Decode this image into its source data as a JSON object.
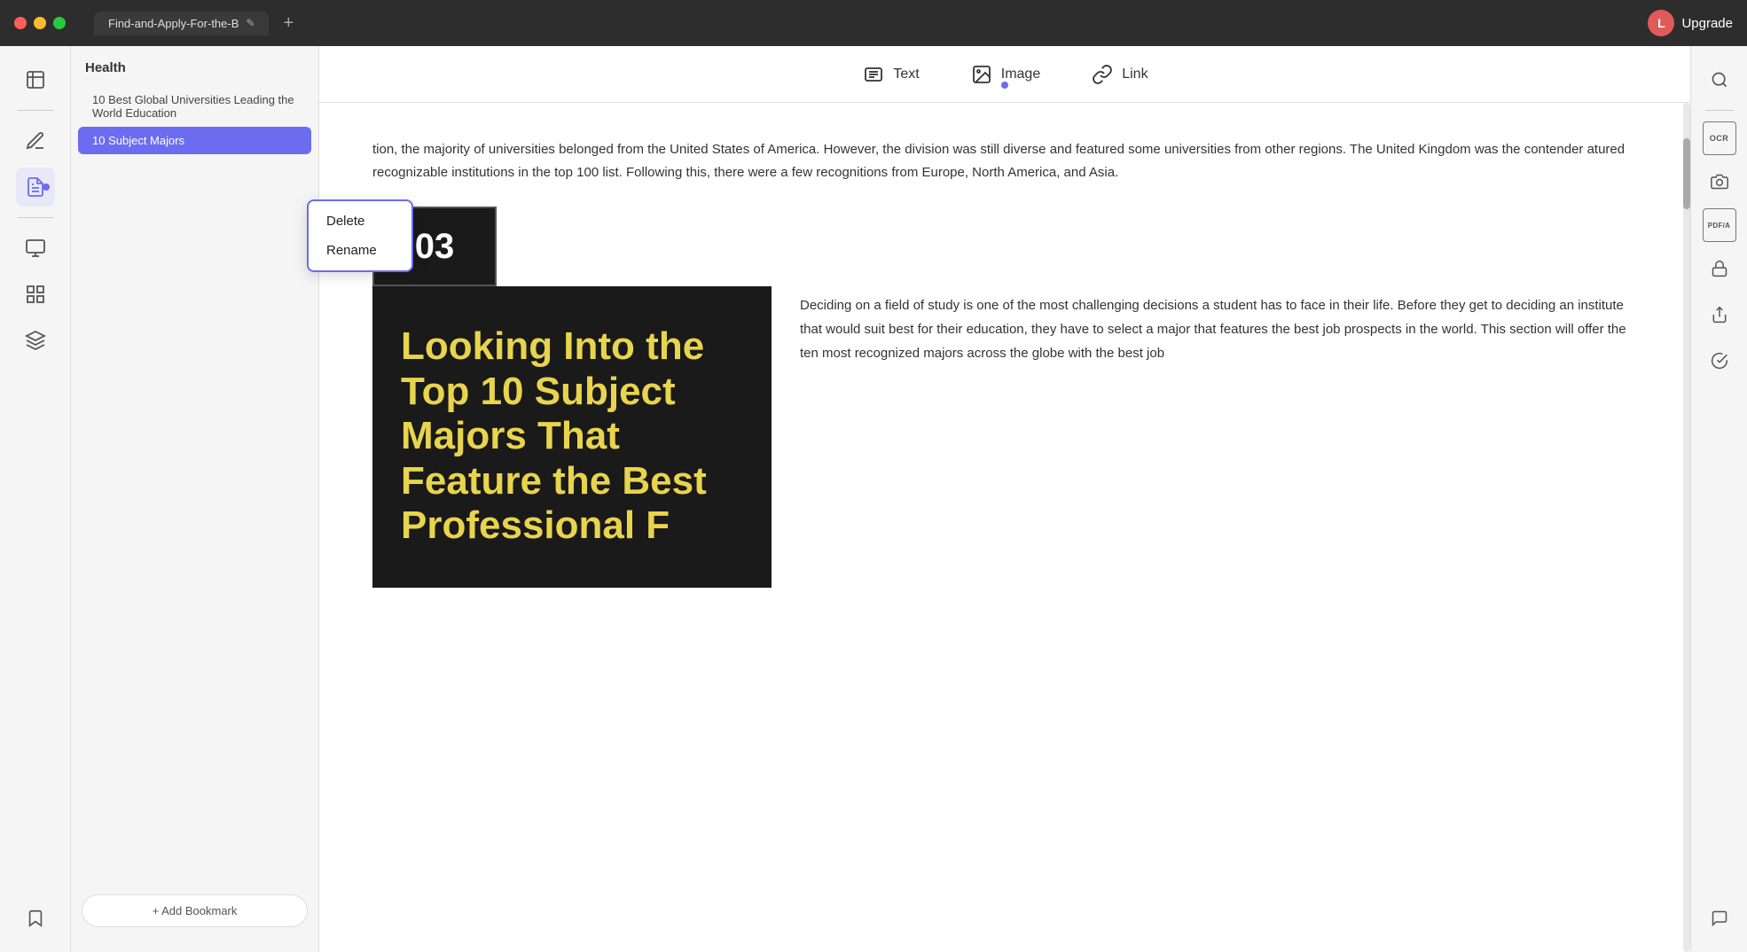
{
  "titlebar": {
    "tab_title": "Find-and-Apply-For-the-B",
    "upgrade_label": "Upgrade",
    "user_initial": "L"
  },
  "left_sidebar": {
    "icons": [
      {
        "name": "bookmarks-icon",
        "symbol": "📑"
      },
      {
        "name": "annotation-icon",
        "symbol": "✏️"
      },
      {
        "name": "notes-icon",
        "symbol": "📝"
      },
      {
        "name": "pages-icon",
        "symbol": "📋"
      },
      {
        "name": "layers-icon",
        "symbol": "⊞"
      },
      {
        "name": "bookmark-add-icon",
        "symbol": "🔖"
      }
    ]
  },
  "panel_sidebar": {
    "section_title": "Health",
    "items": [
      {
        "label": "10 Best Global Universities Leading the World Education"
      },
      {
        "label": "10 Subject Majors",
        "active": true
      }
    ],
    "add_bookmark_label": "+ Add Bookmark"
  },
  "context_menu": {
    "items": [
      {
        "label": "Delete"
      },
      {
        "label": "Rename"
      }
    ]
  },
  "toolbar": {
    "items": [
      {
        "label": "Text",
        "icon": "text-icon"
      },
      {
        "label": "Image",
        "icon": "image-icon"
      },
      {
        "label": "Link",
        "icon": "link-icon"
      }
    ]
  },
  "document": {
    "paragraph1": "tion, the majority of universities belonged from the United States of America. However, the division was still diverse and featured some universities from other regions. The United Kingdom was the contender atured recognizable institutions in the top 100 list. Following this, there were a few recognitions from Europe, North America, and Asia.",
    "section_number": "03",
    "section_image_text": "Looking Into the Top 10 Subject Majors That Feature the Best Professional F",
    "section_body": "Deciding on a field of study is one of the most challenging decisions a student has to face in their life. Before they get to deciding an institute that would suit best for their education, they have to select a major that features the best job prospects in the world. This section will offer the ten most recognized majors across the globe with the best job"
  },
  "right_sidebar": {
    "icons": [
      {
        "name": "search-icon",
        "symbol": "🔍"
      },
      {
        "name": "ocr-icon",
        "label": "OCR"
      },
      {
        "name": "snapshot-icon",
        "symbol": "📷"
      },
      {
        "name": "pdfa-icon",
        "label": "PDF/A"
      },
      {
        "name": "secure-icon",
        "symbol": "🔒"
      },
      {
        "name": "share-icon",
        "symbol": "↑"
      },
      {
        "name": "check-icon",
        "symbol": "✓"
      },
      {
        "name": "chat-icon",
        "symbol": "💬"
      }
    ]
  }
}
